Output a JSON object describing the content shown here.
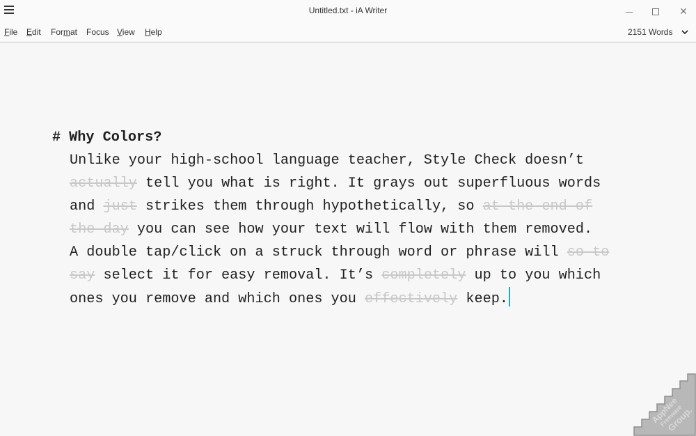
{
  "window": {
    "title": "Untitled.txt - iA Writer",
    "controls": {
      "minimize": "minimize",
      "maximize": "maximize",
      "close": "close"
    }
  },
  "menu": {
    "items": [
      {
        "label": "File",
        "mnemonic": "F",
        "rest": "ile"
      },
      {
        "label": "Edit",
        "mnemonic": "E",
        "rest": "dit"
      },
      {
        "label": "Format",
        "pre": "For",
        "mnemonic": "m",
        "rest": "at"
      },
      {
        "label": "Focus"
      },
      {
        "label": "View",
        "mnemonic": "V",
        "rest": "iew"
      },
      {
        "label": "Help",
        "mnemonic": "H",
        "rest": "elp"
      }
    ],
    "word_count": "2151 Words"
  },
  "document": {
    "heading_marker": "#",
    "heading": "Why Colors?",
    "lines": [
      [
        {
          "t": "Unlike your high-school language teacher, Style Check doesn’t"
        }
      ],
      [
        {
          "t": "actually",
          "s": true
        },
        {
          "t": " tell you what is right. It grays out superfluous words"
        }
      ],
      [
        {
          "t": "and "
        },
        {
          "t": "just",
          "s": true
        },
        {
          "t": " strikes them through hypothetically, so "
        },
        {
          "t": "at the end of",
          "s": true
        }
      ],
      [
        {
          "t": "the day",
          "s": true
        },
        {
          "t": " you can see how your text will flow with them removed."
        }
      ],
      [
        {
          "t": "A double tap/click on a struck through word or phrase will "
        },
        {
          "t": "so to",
          "s": true
        }
      ],
      [
        {
          "t": "say",
          "s": true
        },
        {
          "t": " select it for easy removal. It’s "
        },
        {
          "t": "completely",
          "s": true
        },
        {
          "t": " up to you which"
        }
      ],
      [
        {
          "t": "ones you remove and which ones you "
        },
        {
          "t": "effectively",
          "s": true
        },
        {
          "t": " keep."
        }
      ]
    ]
  },
  "watermark": {
    "line1": "AppNee",
    "line2": "Freeware",
    "line3": "Group."
  },
  "colors": {
    "caret": "#1aa3e8",
    "struck": "#c8c8c8",
    "text": "#1f1f1f"
  }
}
